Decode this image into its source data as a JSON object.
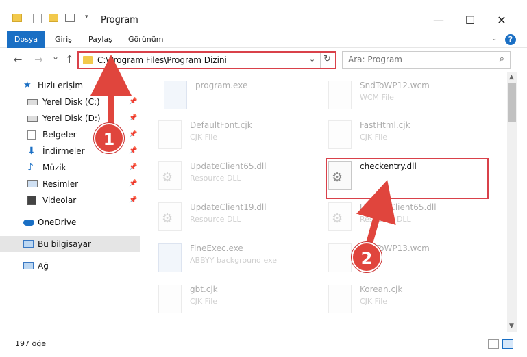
{
  "window": {
    "title": "Program",
    "minimize": "—",
    "maximize": "☐",
    "close": "✕"
  },
  "ribbon": {
    "file_tab": "Dosya",
    "tabs": [
      "Giriş",
      "Paylaş",
      "Görünüm"
    ],
    "chevron": "⌄",
    "help": "?"
  },
  "nav": {
    "back": "←",
    "forward": "→",
    "recent": "⌄",
    "up": "↑",
    "address": "C:\\Program Files\\Program Dizini",
    "address_dropdown": "⌄",
    "refresh": "↻",
    "search_placeholder": "Ara: Program"
  },
  "sidebar": {
    "quick_access": "Hızlı erişim",
    "items": [
      {
        "label": "Yerel Disk (C:)",
        "icon": "drive-icon"
      },
      {
        "label": "Yerel Disk (D:)",
        "icon": "drive-icon"
      },
      {
        "label": "Belgeler",
        "icon": "documents-icon"
      },
      {
        "label": "İndirmeler",
        "icon": "downloads-icon"
      },
      {
        "label": "Müzik",
        "icon": "music-icon"
      },
      {
        "label": "Resimler",
        "icon": "pictures-icon"
      },
      {
        "label": "Videolar",
        "icon": "videos-icon"
      }
    ],
    "onedrive": "OneDrive",
    "this_pc": "Bu bilgisayar",
    "network": "Ağ"
  },
  "files": [
    {
      "name": "program.exe",
      "type": "",
      "icon": "exe"
    },
    {
      "name": "SndToWP12.wcm",
      "type": "WCM File",
      "icon": "doc"
    },
    {
      "name": "DefaultFont.cjk",
      "type": "CJK File",
      "icon": "doc"
    },
    {
      "name": "FastHtml.cjk",
      "type": "CJK File",
      "icon": "doc"
    },
    {
      "name": "UpdateClient65.dll",
      "type": "Resource DLL",
      "icon": "gear"
    },
    {
      "name": "checkentry.dll",
      "type": "",
      "icon": "gear",
      "highlighted": true
    },
    {
      "name": "UpdateClient19.dll",
      "type": "Resource DLL",
      "icon": "gear"
    },
    {
      "name": "UpdateClient65.dll",
      "type": "Resource DLL",
      "icon": "gear"
    },
    {
      "name": "FineExec.exe",
      "type": "ABBYY background exe",
      "icon": "exe"
    },
    {
      "name": "SndToWP13.wcm",
      "type": "",
      "icon": "doc"
    },
    {
      "name": "gbt.cjk",
      "type": "CJK File",
      "icon": "doc"
    },
    {
      "name": "Korean.cjk",
      "type": "CJK File",
      "icon": "doc"
    }
  ],
  "status": {
    "count": "197 öğe"
  },
  "callouts": {
    "one": "1",
    "two": "2"
  },
  "colors": {
    "accent": "#1a6fc4",
    "callout": "#e0453d"
  }
}
